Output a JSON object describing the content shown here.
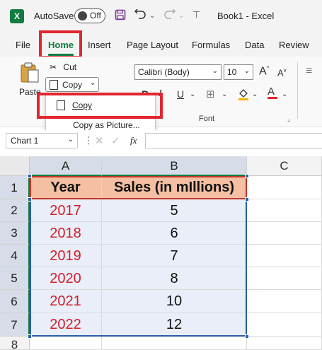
{
  "titlebar": {
    "app_icon": "X",
    "autosave_label": "AutoSave",
    "autosave_state": "Off",
    "doc_title": "Book1  -  Excel"
  },
  "tabs": [
    "File",
    "Home",
    "Insert",
    "Page Layout",
    "Formulas",
    "Data",
    "Review"
  ],
  "ribbon": {
    "paste_label": "Paste",
    "cut_label": "Cut",
    "copy_label": "Copy",
    "font_name": "Calibri (Body)",
    "font_size": "10",
    "bold": "B",
    "italic": "I",
    "underline": "U",
    "font_group_label": "Font",
    "grow_font": "A",
    "shrink_font": "A",
    "font_color": "A"
  },
  "copy_menu": {
    "copy_item": "Copy",
    "copy_as_picture_item": "Copy as Picture..."
  },
  "formula_bar": {
    "name_box": "Chart 1",
    "fx_label": "fx"
  },
  "grid": {
    "columns": [
      "A",
      "B",
      "C"
    ],
    "rows": [
      "1",
      "2",
      "3",
      "4",
      "5",
      "6",
      "7",
      "8"
    ],
    "header": {
      "a": "Year",
      "b": "Sales (in mIllions)"
    },
    "data": [
      {
        "year": "2017",
        "sales": "5"
      },
      {
        "year": "2018",
        "sales": "6"
      },
      {
        "year": "2019",
        "sales": "7"
      },
      {
        "year": "2020",
        "sales": "8"
      },
      {
        "year": "2021",
        "sales": "10"
      },
      {
        "year": "2022",
        "sales": "12"
      }
    ]
  },
  "colors": {
    "accent_green": "#107c41",
    "highlight_red": "#e2262f",
    "header_fill": "#f4bfa2",
    "year_text": "#d21e2b",
    "selection_fill": "#e9eef8"
  }
}
